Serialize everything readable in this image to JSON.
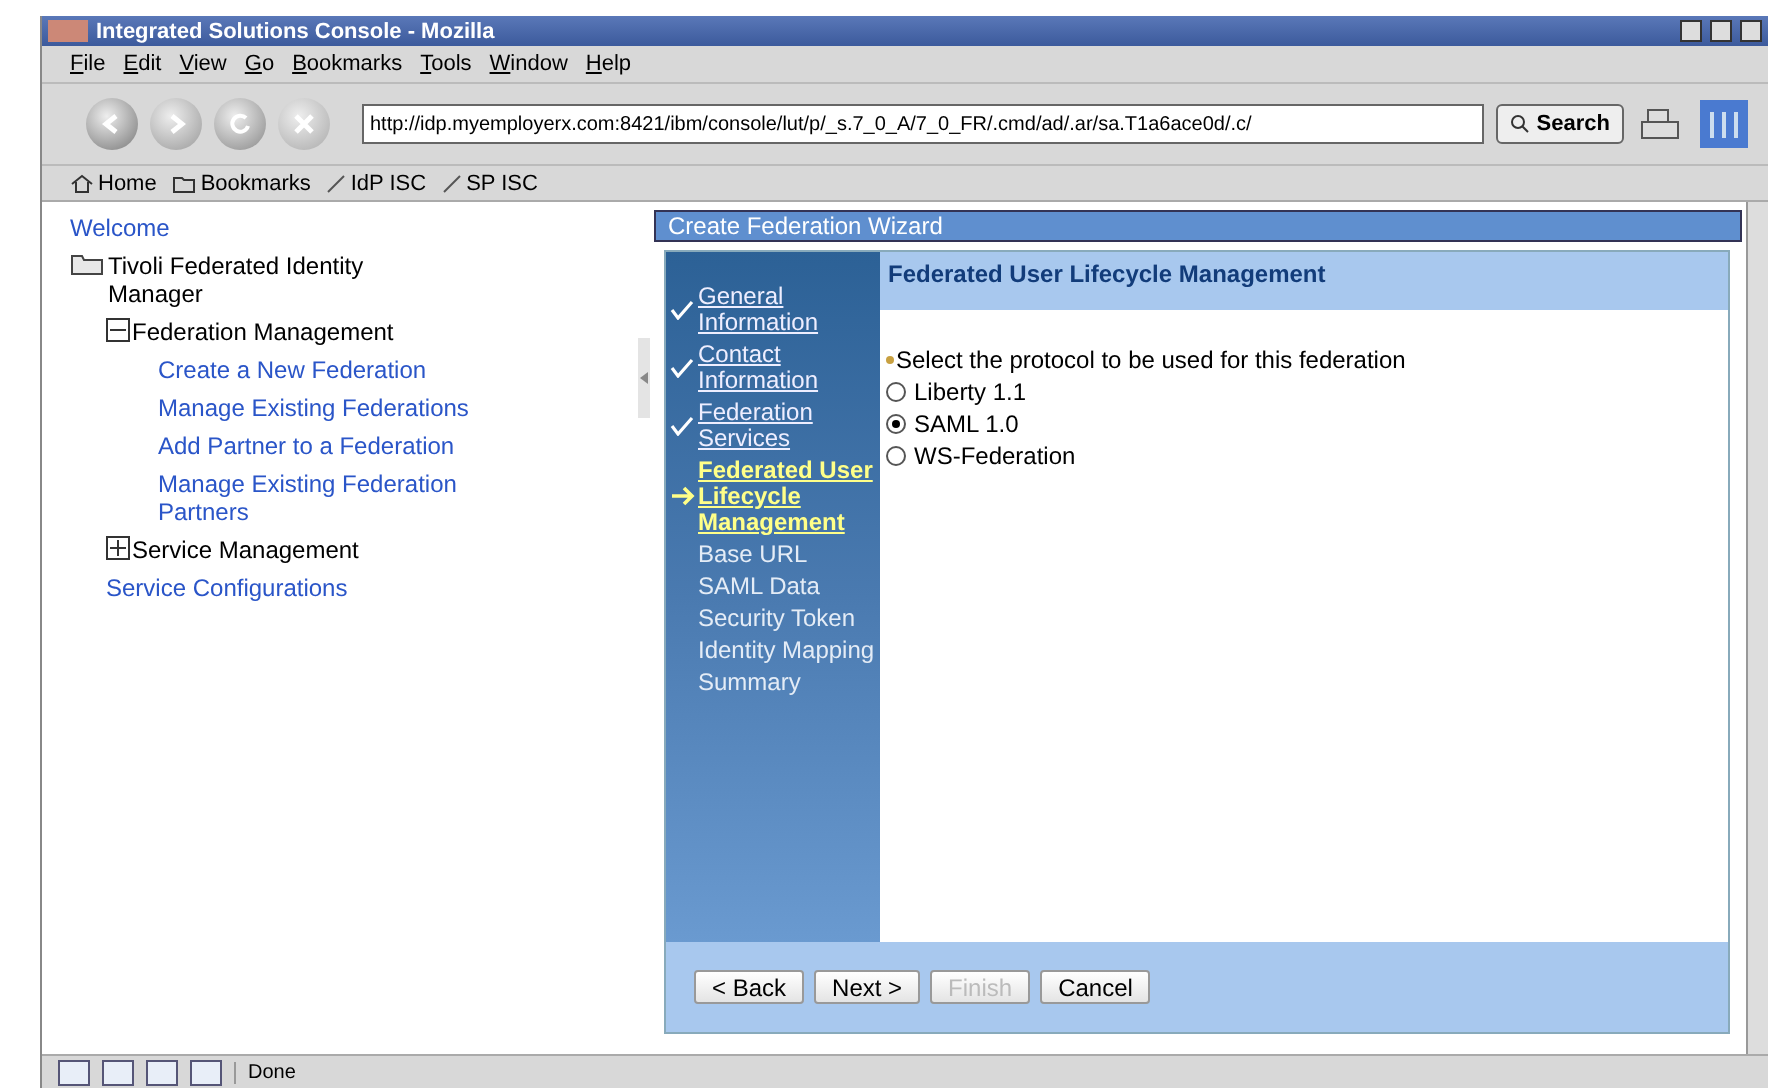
{
  "window": {
    "title": "Integrated Solutions Console - Mozilla"
  },
  "menu": [
    "File",
    "Edit",
    "View",
    "Go",
    "Bookmarks",
    "Tools",
    "Window",
    "Help"
  ],
  "address": {
    "value": "http://idp.myemployerx.com:8421/ibm/console/lut/p/_s.7_0_A/7_0_FR/.cmd/ad/.ar/sa.T1a6ace0d/.c/"
  },
  "search_button": "Search",
  "bookmarks": [
    {
      "kind": "home",
      "label": "Home"
    },
    {
      "kind": "folder",
      "label": "Bookmarks"
    },
    {
      "kind": "link",
      "label": "IdP ISC"
    },
    {
      "kind": "link",
      "label": "SP ISC"
    }
  ],
  "nav": [
    {
      "kind": "link",
      "label": "Welcome"
    },
    {
      "kind": "folder",
      "label": "Tivoli Federated Identity Manager",
      "children": [
        {
          "kind": "group",
          "label": "Federation Management",
          "expanded": true,
          "children": [
            {
              "kind": "link",
              "label": "Create a New Federation"
            },
            {
              "kind": "link",
              "label": "Manage Existing Federations"
            },
            {
              "kind": "link",
              "label": "Add Partner to a Federation"
            },
            {
              "kind": "link",
              "label": "Manage Existing Federation Partners"
            }
          ]
        },
        {
          "kind": "group",
          "label": "Service Management",
          "expanded": false
        },
        {
          "kind": "link",
          "label": "Service Configurations"
        }
      ]
    }
  ],
  "wizard": {
    "title": "Create Federation Wizard",
    "steps": [
      {
        "label": "General Information",
        "kind": "done"
      },
      {
        "label": "Contact Information",
        "kind": "done"
      },
      {
        "label": "Federation Services",
        "kind": "done"
      },
      {
        "label": "Federated User Lifecycle Management",
        "kind": "current"
      },
      {
        "label": "Base URL",
        "kind": "pending"
      },
      {
        "label": "SAML Data",
        "kind": "pending"
      },
      {
        "label": "Security Token",
        "kind": "pending"
      },
      {
        "label": "Identity Mapping",
        "kind": "pending"
      },
      {
        "label": "Summary",
        "kind": "pending"
      }
    ],
    "heading": "Federated User Lifecycle Management",
    "prompt": "Select the protocol to be used for this federation",
    "options": [
      {
        "label": "Liberty 1.1",
        "selected": false
      },
      {
        "label": "SAML 1.0",
        "selected": true
      },
      {
        "label": "WS-Federation",
        "selected": false
      }
    ],
    "buttons": [
      {
        "label": "< Back",
        "disabled": false
      },
      {
        "label": "Next >",
        "disabled": false
      },
      {
        "label": "Finish",
        "disabled": true
      },
      {
        "label": "Cancel",
        "disabled": false
      }
    ]
  },
  "status_bar": {
    "text": "Done"
  }
}
